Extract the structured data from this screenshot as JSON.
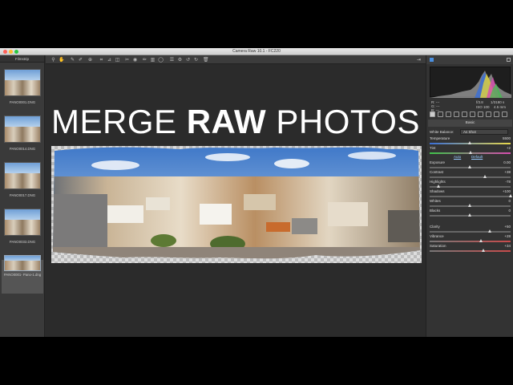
{
  "window": {
    "title": "Camera Raw 10.1  -  FC220"
  },
  "filmstrip": {
    "title": "Filmstrip",
    "items": [
      {
        "name": "PANO0001.DNG"
      },
      {
        "name": "PANO0014.DNG"
      },
      {
        "name": "PANO0017.DNG"
      },
      {
        "name": "PANO0033.DNG"
      },
      {
        "name": "PANO0001- Pano-1.dng"
      }
    ]
  },
  "canvas": {
    "headline_pre": "MERGE ",
    "headline_bold": "RAW",
    "headline_post": " PHOTOS"
  },
  "toolbar": {
    "icons": [
      "zoom-icon",
      "hand-icon",
      "white-balance-icon",
      "color-sampler-icon",
      "targeted-adjust-icon",
      "crop-icon",
      "straighten-icon",
      "transform-icon",
      "spot-removal-icon",
      "red-eye-icon",
      "adjustment-brush-icon",
      "graduated-filter-icon",
      "radial-filter-icon",
      "preferences-icon",
      "rotate-left-icon",
      "rotate-right-icon",
      "trash-icon"
    ]
  },
  "readout": {
    "r": "R:",
    "g": "G:",
    "b": "B:",
    "r_val": "---",
    "g_val": "---",
    "b_val": "---",
    "aperture": "f/3.8",
    "shutter": "1/3180 s",
    "iso": "ISO 100",
    "focal": "4.5 mm"
  },
  "panel": {
    "section": "Basic",
    "white_balance_label": "White Balance:",
    "white_balance_value": "As Shot",
    "auto": "Auto",
    "default": "Default",
    "sliders": [
      {
        "label": "Temperature",
        "value": "5500",
        "pos": 0.5
      },
      {
        "label": "Tint",
        "value": "+2",
        "pos": 0.51
      },
      {
        "label": "Exposure",
        "value": "0.00",
        "pos": 0.5
      },
      {
        "label": "Contrast",
        "value": "+38",
        "pos": 0.69
      },
      {
        "label": "Highlights",
        "value": "-78",
        "pos": 0.11
      },
      {
        "label": "Shadows",
        "value": "+100",
        "pos": 1.0
      },
      {
        "label": "Whites",
        "value": "0",
        "pos": 0.5
      },
      {
        "label": "Blacks",
        "value": "0",
        "pos": 0.5
      },
      {
        "label": "Clarity",
        "value": "+50",
        "pos": 0.75
      },
      {
        "label": "Vibrance",
        "value": "+28",
        "pos": 0.64
      },
      {
        "label": "Saturation",
        "value": "+34",
        "pos": 0.67
      }
    ]
  },
  "colors": {
    "accent": "#4a8fe0",
    "panel_bg": "#333333",
    "canvas_bg": "#2b2b2b"
  }
}
